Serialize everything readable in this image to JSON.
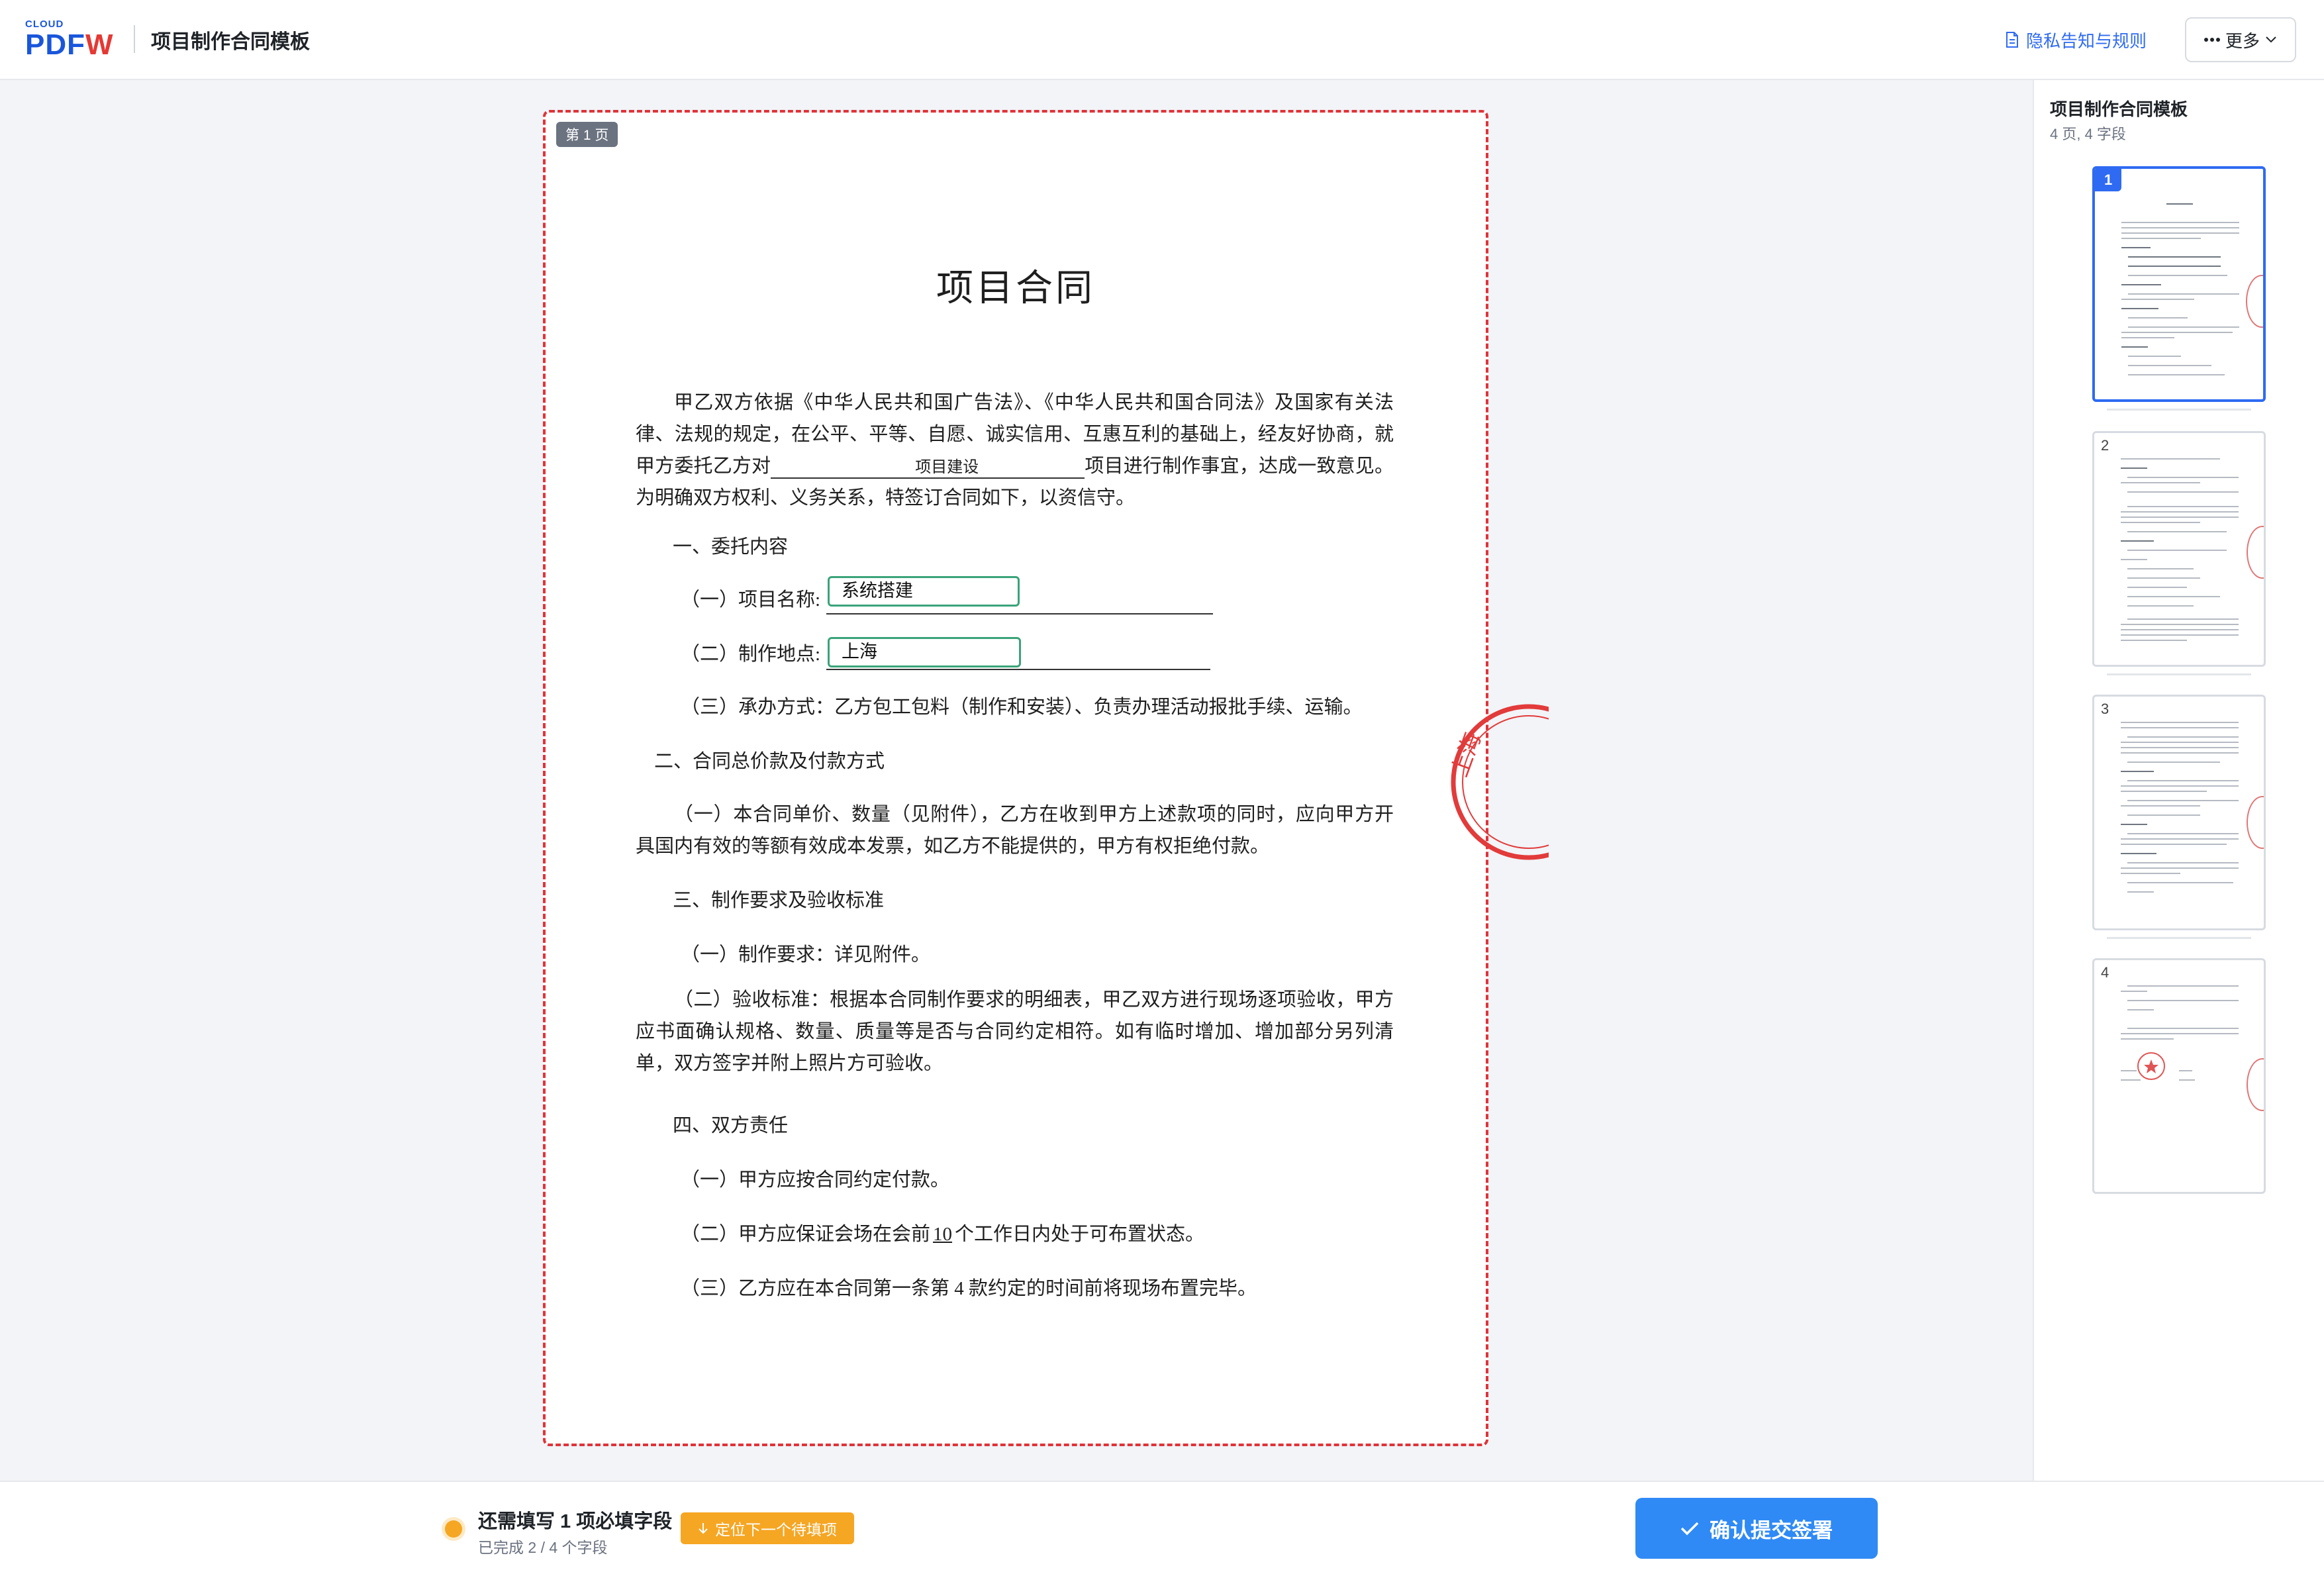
{
  "header": {
    "logo_top": "CLOUD",
    "logo_pdf": "PDF",
    "logo_w": "W",
    "title": "项目制作合同模板",
    "privacy_link": "隐私告知与规则",
    "more_label": "更多",
    "more_icon": "ellipsis-icon"
  },
  "colors": {
    "accent_blue": "#2f6bf2",
    "submit_blue": "#2f8af5",
    "warning_orange": "#f5a623",
    "field_border_green": "#3aa37a",
    "page_border_red": "#e0333a"
  },
  "document": {
    "page_badge": "第 1 页",
    "title": "项目合同",
    "intro_part1": "甲乙双方依据《中华人民共和国广告法》、《中华人民共和国合同法》及国家有关法律、法规的规定，在公平、平等、自愿、诚实信用、互惠互利的基础上，经友好协商，就甲方委托乙方对",
    "intro_fill": "项目建设",
    "intro_part2": "项目进行制作事宜，达成一致意见。为明确双方权利、义务关系，特签订合同如下，以资信守。",
    "s1_title": "一、委托内容",
    "s1_item1_label": "（一）项目名称:",
    "s1_item1_value": "系统搭建",
    "s1_item2_label": "（二）制作地点:",
    "s1_item2_value": "上海",
    "s1_item3": "（三）承办方式：乙方包工包料（制作和安装）、负责办理活动报批手续、运输。",
    "s2_title": "二、合同总价款及付款方式",
    "s2_item1": "（一）本合同单价、数量（见附件），乙方在收到甲方上述款项的同时，应向甲方开具国内有效的等额有效成本发票，如乙方不能提供的，甲方有权拒绝付款。",
    "s3_title": "三、制作要求及验收标准",
    "s3_item1": "（一）制作要求：详见附件。",
    "s3_item2": "（二）验收标准：根据本合同制作要求的明细表，甲乙双方进行现场逐项验收，甲方应书面确认规格、数量、质量等是否与合同约定相符。如有临时增加、增加部分另列清单，双方签字并附上照片方可验收。",
    "s4_title": "四、双方责任",
    "s4_item1": "（一）甲方应按合同约定付款。",
    "s4_item2_a": "（二）甲方应保证会场在会前",
    "s4_item2_num": "10",
    "s4_item2_b": "个工作日内处于可布置状态。",
    "s4_item3": "（三）乙方应在本合同第一条第 4 款约定的时间前将现场布置完毕。",
    "stamp_text": "上海"
  },
  "sidebar": {
    "title": "项目制作合同模板",
    "subtitle": "4 页, 4 字段",
    "thumbnails": [
      {
        "num": "1",
        "active": true
      },
      {
        "num": "2",
        "active": false
      },
      {
        "num": "3",
        "active": false
      },
      {
        "num": "4",
        "active": false
      }
    ]
  },
  "footer": {
    "status_main": "还需填写 1 项必填字段",
    "status_sub": "已完成 2 / 4 个字段",
    "locate_button": "定位下一个待填项",
    "locate_icon": "arrow-down-icon",
    "submit_button": "确认提交签署",
    "submit_icon": "check-icon"
  }
}
